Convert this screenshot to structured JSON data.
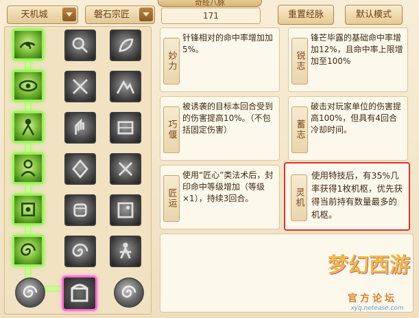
{
  "header": {
    "school_dropdown": "天机城",
    "branch_dropdown": "磐石宗匠",
    "title_tab": "奇经八脉",
    "points_value": "171",
    "reset_button": "重置经脉",
    "default_mode_button": "默认模式"
  },
  "skill_tree": {
    "left_column": [
      "active-node",
      "active-node",
      "active-node",
      "active-node",
      "active-node",
      "active-node"
    ],
    "bottom_icons": [
      "spiral-orb-icon",
      "selected-chest-icon",
      "spiral-orb-icon"
    ]
  },
  "cards": [
    {
      "label": "妙力",
      "desc": "针锋相对的命中率增加加5%。"
    },
    {
      "label": "锐志",
      "desc": "锋芒毕露的基础命中率增加12%，且命中率上限增加至100%"
    },
    {
      "label": "巧偃",
      "desc": "被诱袭的目标本回合受到的伤害提高10%。（不包括固定伤害）"
    },
    {
      "label": "蓄志",
      "desc": "破击对玩家单位的伤害提高100%，但具有4回合冷却时间。"
    },
    {
      "label": "匠运",
      "desc": "使用“匠心”类法术后，封印命中等级增加（等级×1），持续3回合。"
    },
    {
      "label": "灵机",
      "desc": "使用特技后，有35%几率获得1枚机枢，优先获得当前持有数量最多的机枢。"
    }
  ],
  "watermark": {
    "logo": "梦幻西游",
    "sub": "官方论坛",
    "url": "xyq.netease.com"
  }
}
